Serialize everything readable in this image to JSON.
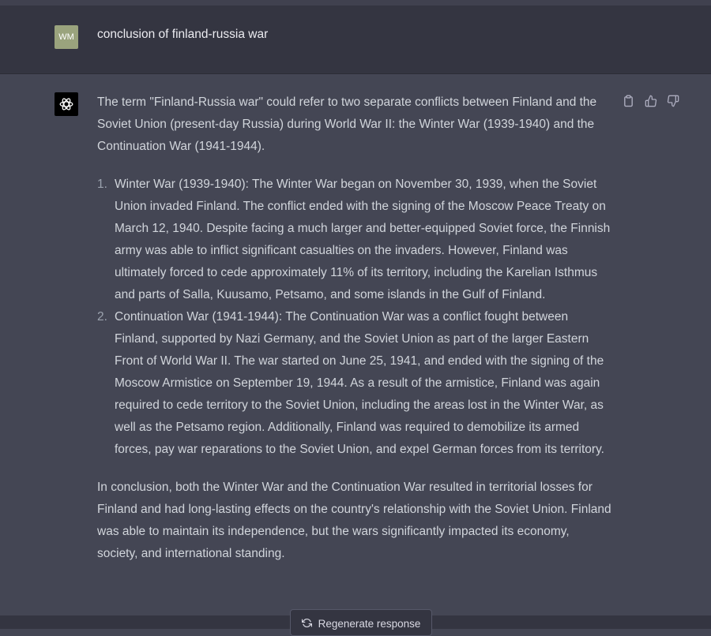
{
  "user": {
    "avatar_initials": "WM",
    "message": "conclusion of finland-russia war"
  },
  "assistant": {
    "intro": "The term \"Finland-Russia war\" could refer to two separate conflicts between Finland and the Soviet Union (present-day Russia) during World War II: the Winter War (1939-1940) and the Continuation War (1941-1944).",
    "items": [
      {
        "number": "1.",
        "text": "Winter War (1939-1940): The Winter War began on November 30, 1939, when the Soviet Union invaded Finland. The conflict ended with the signing of the Moscow Peace Treaty on March 12, 1940. Despite facing a much larger and better-equipped Soviet force, the Finnish army was able to inflict significant casualties on the invaders. However, Finland was ultimately forced to cede approximately 11% of its territory, including the Karelian Isthmus and parts of Salla, Kuusamo, Petsamo, and some islands in the Gulf of Finland."
      },
      {
        "number": "2.",
        "text": "Continuation War (1941-1944): The Continuation War was a conflict fought between Finland, supported by Nazi Germany, and the Soviet Union as part of the larger Eastern Front of World War II. The war started on June 25, 1941, and ended with the signing of the Moscow Armistice on September 19, 1944. As a result of the armistice, Finland was again required to cede territory to the Soviet Union, including the areas lost in the Winter War, as well as the Petsamo region. Additionally, Finland was required to demobilize its armed forces, pay war reparations to the Soviet Union, and expel German forces from its territory."
      }
    ],
    "conclusion": "In conclusion, both the Winter War and the Continuation War resulted in territorial losses for Finland and had long-lasting effects on the country's relationship with the Soviet Union. Finland was able to maintain its independence, but the wars significantly impacted its economy, society, and international standing."
  },
  "actions": {
    "icons": [
      "clipboard-icon",
      "thumbs-up-icon",
      "thumbs-down-icon"
    ]
  },
  "regenerate": {
    "label": "Regenerate response",
    "icon": "refresh-icon"
  },
  "colors": {
    "user_bg": "#343541",
    "assistant_bg": "#444654",
    "user_avatar": "#9aa37d",
    "text": "#d1d5db"
  }
}
